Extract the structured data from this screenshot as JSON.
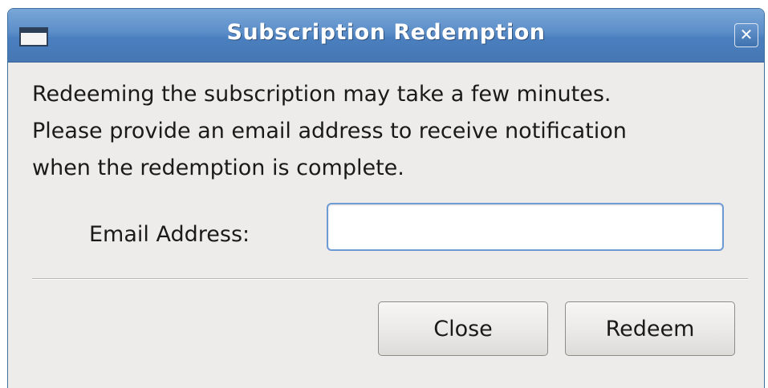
{
  "window": {
    "title": "Subscription Redemption",
    "close_glyph": "✕"
  },
  "message": "Redeeming the subscription may take a few minutes.\nPlease provide an email address to receive notification\nwhen the redemption is complete.",
  "form": {
    "email_label": "Email Address:",
    "email_value": "",
    "email_placeholder": ""
  },
  "buttons": {
    "close_label": "Close",
    "redeem_label": "Redeem"
  },
  "icons": {
    "window_icon": "window-icon",
    "close_icon": "close-icon"
  },
  "colors": {
    "titlebar": "#4a7fbf",
    "dialog_bg": "#edeceb",
    "input_focus_border": "#6f9bd4"
  }
}
